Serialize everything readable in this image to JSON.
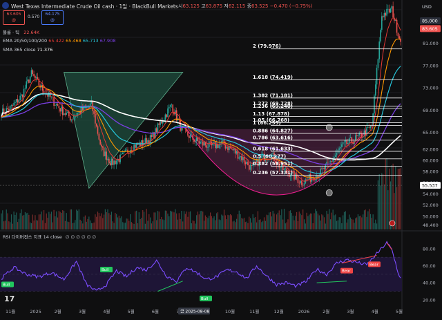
{
  "header": {
    "symbol_title": "West Texas Intermediate Crude Oil cash · 1일 · BlackBull Markets",
    "ohlc": {
      "open_label": "시",
      "open": "63.125",
      "high_label": "고",
      "high": "63.875",
      "low_label": "저",
      "low": "62.115",
      "close_label": "종",
      "close": "63.525",
      "change": "−0.470 (−0.75%)"
    },
    "sell_price": "63.605",
    "sell_sub": "@",
    "spread": "0.570",
    "buy_price": "64.175",
    "buy_sub": "@",
    "volume_label": "볼륨 · 틱",
    "volume_value": "22.64K",
    "ema_label": "EMA 20/50/100/200",
    "ema_values": [
      "65.422",
      "65.468",
      "65.713",
      "67.908"
    ],
    "sma_label": "SMA 365 close",
    "sma_value": "71.376",
    "currency": "USD"
  },
  "fib_levels": [
    {
      "label": "2 (79.976)",
      "price": 79.976
    },
    {
      "label": "1.618 (74.419)",
      "price": 74.419
    },
    {
      "label": "1.382 (71.181)",
      "price": 71.181
    },
    {
      "label": "1.272 (69.728)",
      "price": 69.728
    },
    {
      "label": "1.236 (69.240)",
      "price": 69.24
    },
    {
      "label": "1.13 (67.878)",
      "price": 67.878
    },
    {
      "label": "1.05 (66.768)",
      "price": 66.768
    },
    {
      "label": "1 (66.255)",
      "price": 66.255
    },
    {
      "label": "0.886 (64.827)",
      "price": 64.827
    },
    {
      "label": "0.786 (63.616)",
      "price": 63.616
    },
    {
      "label": "0.618 (61.633)",
      "price": 61.633
    },
    {
      "label": "0.5 (60.277)",
      "price": 60.277
    },
    {
      "label": "0.382 (58.951)",
      "price": 58.951
    },
    {
      "label": "0.236 (57.331)",
      "price": 57.331
    }
  ],
  "price_axis": {
    "ticks": [
      "85.000",
      "81.000",
      "77.000",
      "73.000",
      "69.000",
      "65.000",
      "62.000",
      "60.000",
      "58.000",
      "56.000",
      "54.000",
      "52.000",
      "50.000",
      "48.400"
    ],
    "current_price": "63.605",
    "reference_price": "55.537",
    "tags": [
      "85.000",
      "83.605",
      "55.537"
    ]
  },
  "time_axis": {
    "labels": [
      "11월",
      "2025",
      "2월",
      "3월",
      "4월",
      "5월",
      "6월",
      "7월",
      "9월",
      "10월",
      "11월",
      "12월",
      "2026",
      "2월",
      "3월",
      "4월",
      "5월"
    ],
    "cursor_date": "금 2025-08-08"
  },
  "rsi": {
    "label": "RSI 다이버전스 지표 14 close",
    "values": "∅ ∅ ∅ ∅ ∅ ∅",
    "ticks": [
      "80.00",
      "60.00",
      "40.00",
      "20.00"
    ],
    "signals": [
      {
        "label": "Bull",
        "color": "#22c55e"
      },
      {
        "label": "Bull",
        "color": "#22c55e"
      },
      {
        "label": "Bull",
        "color": "#22c55e"
      },
      {
        "label": "Bear",
        "color": "#ef4444"
      },
      {
        "label": "Bear",
        "color": "#ef4444"
      }
    ]
  },
  "colors": {
    "background": "#0f0f10",
    "candle_up": "#26a69a",
    "candle_down": "#ef5350",
    "sma365": "#ffffff",
    "ema20": "#e53935",
    "ema50": "#ff9800",
    "ema100": "#26c6da",
    "ema200": "#7b3fe4",
    "rsi_line": "#7c4dff",
    "triangle_fill": "#1f4d3d",
    "arc_fill": "#4a1f3d",
    "arc_stroke": "#e91e8c"
  },
  "chart_data": {
    "type": "line",
    "title": "West Texas Intermediate Crude Oil cash · 1일 · BlackBull Markets",
    "x_start_label": "11월",
    "x_end_label": "5월",
    "ylim": [
      47.5,
      87
    ],
    "price_ohlc": {
      "open": 63.125,
      "high": 63.875,
      "low": 62.115,
      "close": 63.525,
      "change": -0.47,
      "change_pct": -0.75
    },
    "close_anchors": {
      "x": [
        0,
        8,
        16,
        24,
        32,
        40,
        48,
        56,
        64,
        72,
        80,
        88,
        96,
        104,
        112,
        120,
        128,
        136,
        144,
        152,
        160,
        168,
        176,
        184,
        192,
        200,
        208,
        216,
        224,
        232,
        240,
        248,
        256,
        264,
        272,
        280,
        288,
        296,
        304,
        312,
        318
      ],
      "y": [
        68.5,
        69.5,
        71.5,
        75.5,
        73.0,
        71.0,
        69.0,
        67.5,
        69.0,
        70.0,
        62.0,
        59.5,
        60.5,
        62.5,
        63.0,
        64.0,
        67.0,
        70.0,
        65.5,
        64.0,
        63.0,
        62.5,
        63.0,
        62.0,
        60.5,
        58.5,
        60.5,
        61.0,
        58.5,
        57.5,
        56.0,
        57.0,
        58.0,
        60.0,
        62.5,
        63.5,
        64.5,
        66.0,
        86.0,
        87.0,
        82.0
      ]
    },
    "series": [
      {
        "name": "EMA 20",
        "value": 65.422
      },
      {
        "name": "EMA 50",
        "value": 65.468
      },
      {
        "name": "EMA 100",
        "value": 65.713
      },
      {
        "name": "EMA 200",
        "value": 67.908
      },
      {
        "name": "SMA 365 close",
        "value": 71.376
      }
    ],
    "rsi_anchors": {
      "x": [
        0,
        10,
        20,
        30,
        40,
        50,
        60,
        68,
        76,
        84,
        92,
        100,
        108,
        116,
        124,
        132,
        140,
        148,
        156,
        164,
        172,
        180,
        188,
        196,
        204,
        212,
        220,
        228,
        236,
        244,
        252,
        260,
        268,
        276,
        284,
        292,
        300,
        308,
        312,
        318
      ],
      "y": [
        45,
        58,
        50,
        47,
        52,
        44,
        65,
        38,
        30,
        38,
        54,
        47,
        58,
        55,
        66,
        48,
        42,
        58,
        52,
        44,
        47,
        55,
        53,
        45,
        60,
        48,
        38,
        40,
        36,
        42,
        56,
        50,
        63,
        67,
        64,
        61,
        74,
        87,
        79,
        47
      ]
    },
    "rsi_ylim": [
      15,
      92
    ]
  }
}
